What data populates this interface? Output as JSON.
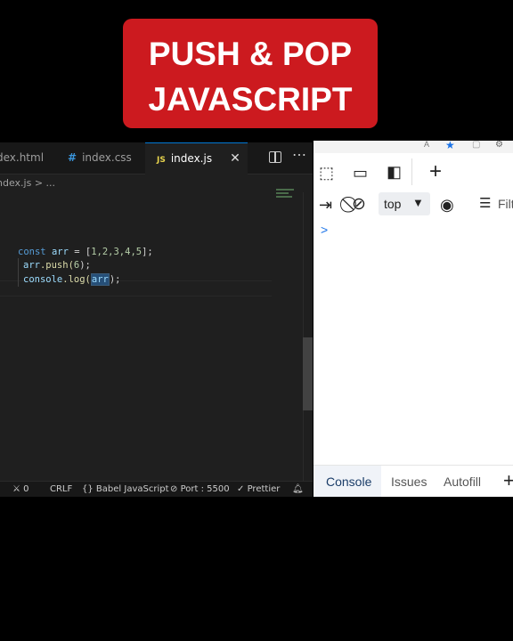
{
  "title": {
    "line1": "PUSH & POP",
    "line2": "JAVASCRIPT"
  },
  "editor": {
    "tabs": [
      {
        "label": "dex.html"
      },
      {
        "label": "index.css",
        "icon": "#"
      },
      {
        "label": "index.js",
        "icon": "JS",
        "close": "✕"
      }
    ],
    "breadcrumb": "ndex.js > ...",
    "code": {
      "l1_kw": "const",
      "l1_var": "arr",
      "l1_rest": " = [",
      "l1_nums": "1,2,3,4,5",
      "l1_end": "];",
      "l2_var": "arr",
      "l2_fn": ".push(",
      "l2_num": "6",
      "l2_end": ");",
      "l3_obj": "console",
      "l3_fn": ".log(",
      "l3_arg": "arr",
      "l3_end": ");"
    },
    "status": {
      "errors": "0",
      "eol": "CRLF",
      "language": "Babel JavaScript",
      "port": "Port : 5500",
      "prettier": "Prettier"
    }
  },
  "devtools": {
    "context": "top",
    "filter": "Filt",
    "tabs": [
      "Console",
      "Issues",
      "Autofill"
    ],
    "add_tab": "+"
  },
  "colors": {
    "title_bg": "#cc1a1f",
    "editor_bg": "#1f1f1f",
    "accent": "#0078d4"
  }
}
